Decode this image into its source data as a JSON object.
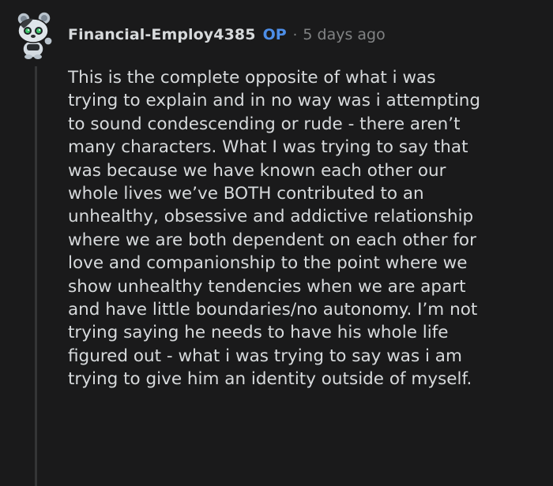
{
  "comment": {
    "author": "Financial-Employ4385",
    "badge": "OP",
    "separator": "·",
    "timestamp": "5 days ago",
    "avatar_icon": "snoo-avatar-icon",
    "body": "This is the complete opposite of what i was\ntrying to explain and in no way was i attempting\nto sound condescending or rude - there aren’t\nmany characters. What I was trying to say that\nwas because we have known each other our\nwhole lives we’ve BOTH contributed to an\nunhealthy, obsessive and addictive relationship\nwhere we are both dependent on each other for\nlove and companionship to the point where we\nshow unhealthy tendencies when we are apart\nand have little boundaries/no autonomy. I’m not\ntrying saying he needs to have his whole life\nfigured out - what i was trying to say was i am\ntrying to give him an identity outside of myself."
  },
  "colors": {
    "background": "#1a1a1b",
    "text": "#d7dadc",
    "op_badge": "#4d8ee8",
    "muted": "#818384",
    "thread_line": "#343536"
  }
}
